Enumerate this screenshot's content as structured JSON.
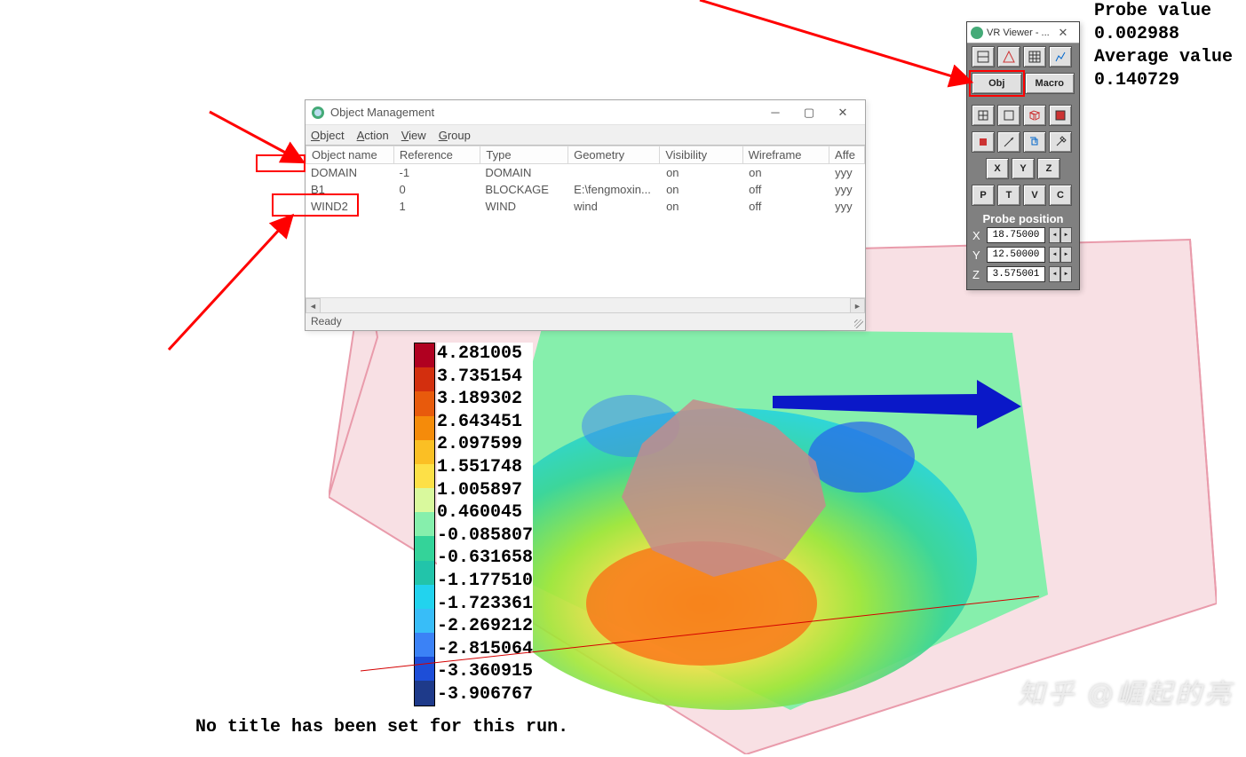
{
  "topright": {
    "line0": "Probe value",
    "val0": "0.002988",
    "line1": "Average value",
    "val1": "0.140729"
  },
  "no_title_msg": "No title has been set for this run.",
  "watermark": "知乎 @崛起的亮",
  "legend": {
    "colors": [
      "#b00020",
      "#d32f0e",
      "#e85a0c",
      "#f58b0a",
      "#fbbf24",
      "#fde047",
      "#d9f99d",
      "#86efac",
      "#34d399",
      "#22c4aa",
      "#22d3ee",
      "#38bdf8",
      "#3b82f6",
      "#1d4ed8",
      "#1e3a8a"
    ],
    "values": [
      "4.281005",
      "3.735154",
      "3.189302",
      "2.643451",
      "2.097599",
      "1.551748",
      "1.005897",
      "0.460045",
      "-0.085807",
      "-0.631658",
      "-1.177510",
      "-1.723361",
      "-2.269212",
      "-2.815064",
      "-3.360915",
      "-3.906767"
    ]
  },
  "om": {
    "title": "Object Management",
    "menus": [
      "Object",
      "Action",
      "View",
      "Group"
    ],
    "columns": [
      "Object name",
      "Reference",
      "Type",
      "Geometry",
      "Visibility",
      "Wireframe",
      "Affe"
    ],
    "rows": [
      {
        "name": "DOMAIN",
        "ref": "-1",
        "type": "DOMAIN",
        "geom": "",
        "vis": "on",
        "wire": "on",
        "aff": "yyy"
      },
      {
        "name": "B1",
        "ref": "0",
        "type": "BLOCKAGE",
        "geom": "E:\\fengmoxin...",
        "vis": "on",
        "wire": "off",
        "aff": "yyy"
      },
      {
        "name": "WIND2",
        "ref": "1",
        "type": "WIND",
        "geom": "wind",
        "vis": "on",
        "wire": "off",
        "aff": "yyy"
      }
    ],
    "status": "Ready"
  },
  "vr": {
    "title": "VR Viewer - ...",
    "obj_btn": "Obj",
    "macro_btn": "Macro",
    "axis_btns": [
      "X",
      "Y",
      "Z"
    ],
    "ptvc_btns": [
      "P",
      "T",
      "V",
      "C"
    ],
    "probe_header": "Probe position",
    "probe": {
      "x_label": "X",
      "x": "18.75000",
      "y_label": "Y",
      "y": "12.50000",
      "z_label": "Z",
      "z": "3.575001"
    }
  }
}
